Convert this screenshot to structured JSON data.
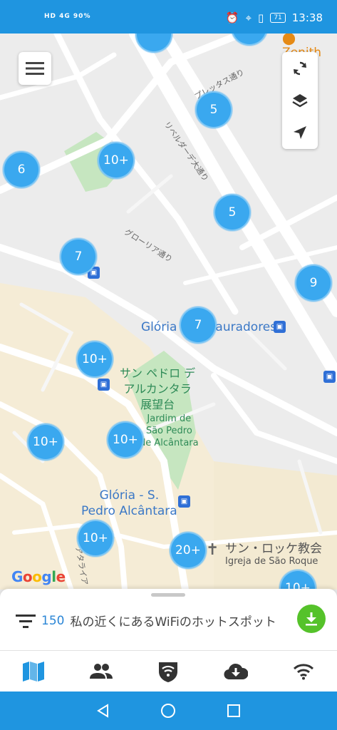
{
  "status_bar": {
    "left_text": "HD 4G 90%",
    "battery": "71",
    "time": "13:38"
  },
  "map": {
    "poi_zenith": "Zenith",
    "poi_gloria_restauradores": "Glória - Restauradores",
    "poi_park_jp": "サン ペドロ デ\nアルカンタラ\n展望台",
    "poi_park_pt": "Jardim de\nSão Pedro\nde Alcântara",
    "poi_gloria_sp": "Glória - S.\nPedro Alcântara",
    "poi_church_jp": "サン・ロッケ教会",
    "poi_church_pt": "Igreja de São Roque",
    "street_1": "リベルダーデ大通り",
    "street_2": "プレッタス通り",
    "street_3": "グローリア通り",
    "street_4": "アタライア",
    "google_logo": "Google",
    "clusters": [
      "5",
      "6",
      "10+",
      "5",
      "7",
      "9",
      "7",
      "10+",
      "10+",
      "10+",
      "10+",
      "20+",
      "10+"
    ],
    "icons": {
      "menu": "menu-icon",
      "refresh": "refresh-icon",
      "layers": "layers-icon",
      "locate": "locate-icon"
    }
  },
  "sheet": {
    "count": "150",
    "title": "私の近くにあるWiFiのホットスポット"
  },
  "tabs": [
    {
      "name": "map-tab",
      "icon": "map-icon",
      "active": true
    },
    {
      "name": "community-tab",
      "icon": "people-icon",
      "active": false
    },
    {
      "name": "vpn-tab",
      "icon": "shield-wifi-icon",
      "active": false
    },
    {
      "name": "download-tab",
      "icon": "cloud-download-icon",
      "active": false
    },
    {
      "name": "wifi-tab",
      "icon": "wifi-icon",
      "active": false
    }
  ],
  "colors": {
    "accent": "#1f95e0",
    "cluster": "#3aa8ef",
    "download": "#55c22a",
    "park": "#c6e6c0"
  }
}
